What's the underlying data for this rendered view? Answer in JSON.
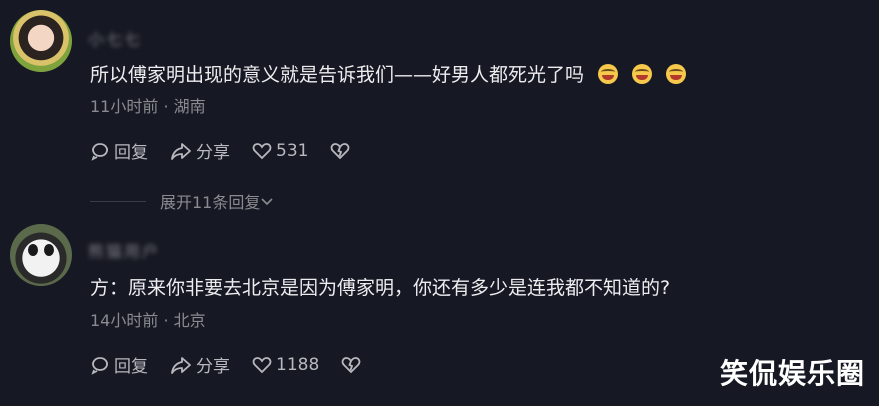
{
  "comments": [
    {
      "username": "小七七",
      "text": "所以傅家明出现的意义就是告诉我们——好男人都死光了吗",
      "emoji_count": 3,
      "time": "11小时前",
      "location": "湖南",
      "reply_label": "回复",
      "share_label": "分享",
      "likes": "531",
      "expand_label": "展开11条回复"
    },
    {
      "username": "熊猫用户",
      "text": "方：原来你非要去北京是因为傅家明，你还有多少是连我都不知道的?",
      "time": "14小时前",
      "location": "北京",
      "reply_label": "回复",
      "share_label": "分享",
      "likes": "1188"
    }
  ],
  "separator": "·",
  "watermark": "笑侃娱乐圈",
  "colors": {
    "background": "#161823",
    "text": "#ededf0",
    "meta": "#8a8b91"
  }
}
